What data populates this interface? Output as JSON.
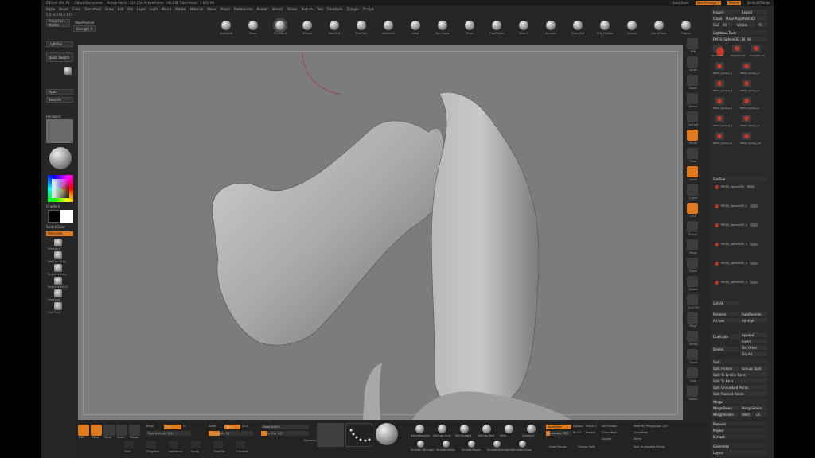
{
  "title": {
    "app": "ZBrush 4R6 P2",
    "doc": "ZBrushDocument",
    "stats": "Active Points: 219,556  ActivePoints: 246,136  Total Points: 1.062 Mil",
    "quicksave": "QuickSave",
    "see_through": "See-through 0",
    "menus": "Menus",
    "default_script": "DefaultZScript"
  },
  "menubar": [
    "Alpha",
    "Brush",
    "Color",
    "Document",
    "Draw",
    "Edit",
    "File",
    "Layer",
    "Light",
    "Macro",
    "Marker",
    "Material",
    "Movie",
    "Picker",
    "Preferences",
    "Render",
    "Stencil",
    "Stroke",
    "Texture",
    "Tool",
    "Transform",
    "Zplugin",
    "Zscript"
  ],
  "coords": "1.5,-0.216,1.672",
  "top_shelf": {
    "projection_master": "Projection Master",
    "lightbox": "LightBox",
    "quick_sketch": "Quick Sketch",
    "rgb_str": "WaxPreview",
    "strength": "Strength 0",
    "brushes": [
      "ClayBuild",
      "Move",
      "Standard",
      "hPolish",
      "DamStd",
      "TrimDyn",
      "dSketch1",
      "Inflat",
      "Clip Curve",
      "Pinch",
      "ClayTubes",
      "Slash3",
      "Smooth",
      "Dam_Std",
      "Orb_Flatten",
      "Cracks",
      "CurveTube",
      "Flatten"
    ]
  },
  "left_shelf": {
    "projection": "Projection Master",
    "lightbox": "LightBox",
    "quick_sketch": "Quick Sketch",
    "open": "Open",
    "save_as": "Save As",
    "fillobject": "FillObject",
    "gradient": "Gradient",
    "switch_color": "SwitchColor",
    "alternate": "Alternate",
    "tools": [
      "Standard",
      "MatCap Gray",
      "BasicMaterial",
      "BasicMaterial2",
      "Gradient",
      "Flat Color"
    ]
  },
  "right_shelf": {
    "labels": [
      "BPR",
      "Scroll",
      "Zoom",
      "Actual",
      "AAHalf",
      "Persp",
      "Floor",
      "Local",
      "L.Sym",
      "XYZ",
      "Frame",
      "Move",
      "Scale",
      "Rotate",
      "Line Fill",
      "PolyF",
      "Transp",
      "Ghost",
      "Solo",
      "Xpose"
    ]
  },
  "palette": {
    "import": "Import",
    "export": "Export",
    "clone": "Clone",
    "make_polymesh": "Make PolyMesh3D",
    "goz": "GoZ",
    "all": "All",
    "visible": "Visible",
    "r": "R",
    "lightbox_tools": "Lightbox▸Tools",
    "current_tool": "PM3D_Sphere3D_16. 48",
    "tools": [
      "Sphere3D",
      "PolyMesh3D",
      "SimpleBrush",
      "PM3D_Sphere_1",
      "PM3D_Sphere_2",
      "PM3D_Sphere_3",
      "PM3D_Sphere_4",
      "PM3D_Sphere_5",
      "PM3D_Sphere_6",
      "PM3D_Sphere_7",
      "PM3D_Sphere_8",
      "PM3D_Sphere_9",
      "PM3D_Sphere_10"
    ],
    "subtool": "SubTool",
    "subtools": [
      "PM3D_Sphere3D",
      "PM3D_Sphere3D_1",
      "PM3D_Sphere3D_2",
      "PM3D_Sphere3D_3",
      "PM3D_Sphere3D_4",
      "PM3D_Sphere3D_5"
    ],
    "list_all": "List All",
    "rename": "Rename",
    "autoreorder": "AutoReorder",
    "all_low": "All Low",
    "all_high": "All High",
    "duplicate": "Duplicate",
    "append": "Append",
    "insert": "Insert",
    "delete": "Delete",
    "del_other": "Del Other",
    "del_all": "Del All",
    "split": "Split",
    "split_hidden": "Split Hidden",
    "groups_split": "Groups Split",
    "split_similar": "Split To Similar Parts",
    "split_parts": "Split To Parts",
    "split_unmasked": "Split Unmasked Points",
    "split_masked": "Split Masked Points",
    "merge": "Merge",
    "merge_down": "MergeDown",
    "merge_similar": "MergeSimilar",
    "merge_visible": "MergeVisible",
    "weld": "Weld",
    "uv": "Uv",
    "remesh": "Remesh",
    "project": "Project",
    "extract": "Extract",
    "geometry": "Geometry",
    "layers": "Layers"
  },
  "bottom_shelf": {
    "edit": "Edit",
    "draw": "Draw",
    "move": "Move",
    "scale": "Scale",
    "rotate": "Rotate",
    "mrgb": "Mrgb",
    "rgb": "Rgb",
    "m": "M",
    "zadd": "Zadd",
    "zsub": "Zsub",
    "zcut": "Zcut",
    "focal_shift": "Focal Shift 0",
    "draw_size": "Draw Size 141",
    "dynamic": "Dynamic",
    "rgb_intensity": "Rgb Intensity 100",
    "z_intensity": "Z Intensity 25",
    "dynamesh": "DynaMesh",
    "resolution": "Resolution 384",
    "groups": "Groups",
    "polish": "Polish 0",
    "blur": "Blur 2",
    "project": "Project",
    "clear_mask": "Clear Mask",
    "del_hidden": "Del Hidden",
    "mask_by_polygroups": "Mask By Polygroups 100",
    "double": "Double",
    "mirror": "Mirror",
    "auto_groups": "Auto Groups",
    "groups_split": "Groups Split",
    "split_unmasked": "Split Unmasked Points",
    "brush_labels": [
      "BasicMaterial",
      "MatCap Gray",
      "SkinShade4",
      "MatCap Red",
      "Dots",
      "Gradient",
      "Standard",
      "ClayTubes"
    ],
    "lower_labels": [
      "Smooth Stronger",
      "SmoothValley",
      "SmoothPeaks",
      "SmoothDirectional",
      "SmoothCurve"
    ],
    "strokes": [
      "Dots",
      "DragRect",
      "FreeHand",
      "Spray",
      "DragDot",
      "Colorized"
    ]
  }
}
